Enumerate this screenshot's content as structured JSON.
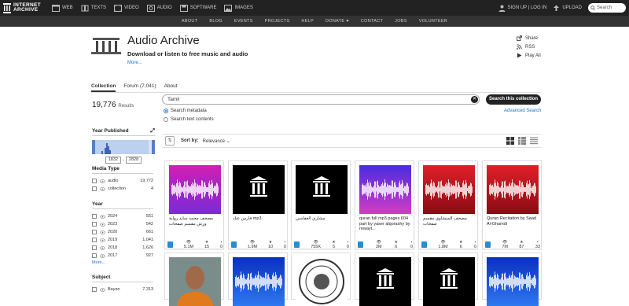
{
  "topnav": {
    "logo_line1": "INTERNET",
    "logo_line2": "ARCHIVE",
    "media": [
      {
        "label": "WEB",
        "icon": "web-icon"
      },
      {
        "label": "TEXTS",
        "icon": "book-icon"
      },
      {
        "label": "VIDEO",
        "icon": "film-icon"
      },
      {
        "label": "AUDIO",
        "icon": "speaker-icon"
      },
      {
        "label": "SOFTWARE",
        "icon": "floppy-icon"
      },
      {
        "label": "IMAGES",
        "icon": "image-icon"
      }
    ],
    "signup": "SIGN UP | LOG IN",
    "upload": "UPLOAD",
    "search_placeholder": "Search"
  },
  "subnav": [
    "ABOUT",
    "BLOG",
    "EVENTS",
    "PROJECTS",
    "HELP",
    "DONATE",
    "CONTACT",
    "JOBS",
    "VOLUNTEER"
  ],
  "donate_heart": "♥",
  "collection": {
    "logo_text": "AUDIO ARCHIVE",
    "title": "Audio Archive",
    "subtitle": "Download or listen to free music and audio",
    "more": "More..."
  },
  "side_links": [
    "Share",
    "RSS",
    "Play All"
  ],
  "tabs": [
    "Collection",
    "Forum (7,041)",
    "About"
  ],
  "results": {
    "count": "19,776",
    "label": "Results"
  },
  "search": {
    "query": "Tamil",
    "clear": "✕",
    "button": "Search this collection",
    "opt1": "Search metadata",
    "opt2": "Search text contents",
    "advanced": "Advanced Search"
  },
  "sort": {
    "icon": "⇅",
    "label": "Sort by:",
    "value": "Relevance ⌄"
  },
  "year_published": {
    "title": "Year Published",
    "expand": "⤢",
    "from": "1832",
    "dash": "-",
    "to": "2828"
  },
  "facets": {
    "media_type": {
      "title": "Media Type",
      "rows": [
        {
          "label": "audio",
          "count": "19,772"
        },
        {
          "label": "collection",
          "count": "4"
        }
      ]
    },
    "year": {
      "title": "Year",
      "rows": [
        {
          "label": "2024",
          "count": "551"
        },
        {
          "label": "2023",
          "count": "542"
        },
        {
          "label": "2020",
          "count": "661"
        },
        {
          "label": "2019",
          "count": "1,041"
        },
        {
          "label": "2018",
          "count": "1,626"
        },
        {
          "label": "2017",
          "count": "927"
        }
      ],
      "more": "More..."
    },
    "subject": {
      "title": "Subject",
      "rows": [
        {
          "label": "Bayan",
          "count": "7,313"
        }
      ]
    }
  },
  "items": [
    {
      "title": "مصحف محمد سايد رواية ورش مقسم صفحات",
      "views": "5.1M",
      "favs": "15",
      "reviews": "0",
      "thumb": "purple"
    },
    {
      "title": "فارس عباد mp3",
      "views": "1.9M",
      "favs": "10",
      "reviews": "0",
      "thumb": "temple"
    },
    {
      "title": "مشاري العفاسي",
      "views": "755K",
      "favs": "5",
      "reviews": "0",
      "thumb": "temple"
    },
    {
      "title": "quran full mp3 pages 604 part by yaser alqorashy by rewayt...",
      "views": "2M",
      "favs": "6",
      "reviews": "0",
      "thumb": "violet"
    },
    {
      "title": "مصحف المنشاوي مقسم صفحات",
      "views": "1.8M",
      "favs": "6",
      "reviews": "0",
      "thumb": "red"
    },
    {
      "title": "Quran Recitation by Saad Al-Ghamdi",
      "views": "7M",
      "favs": "87",
      "reviews": "33",
      "thumb": "red"
    }
  ],
  "row2": [
    {
      "thumb": "person"
    },
    {
      "thumb": "blue"
    },
    {
      "thumb": "seal"
    },
    {
      "thumb": "temple"
    },
    {
      "thumb": "temple"
    },
    {
      "thumb": "blue"
    }
  ],
  "colors": {
    "accent": "#1a73c9",
    "dark": "#222222",
    "donate_heart": "#e33333"
  }
}
